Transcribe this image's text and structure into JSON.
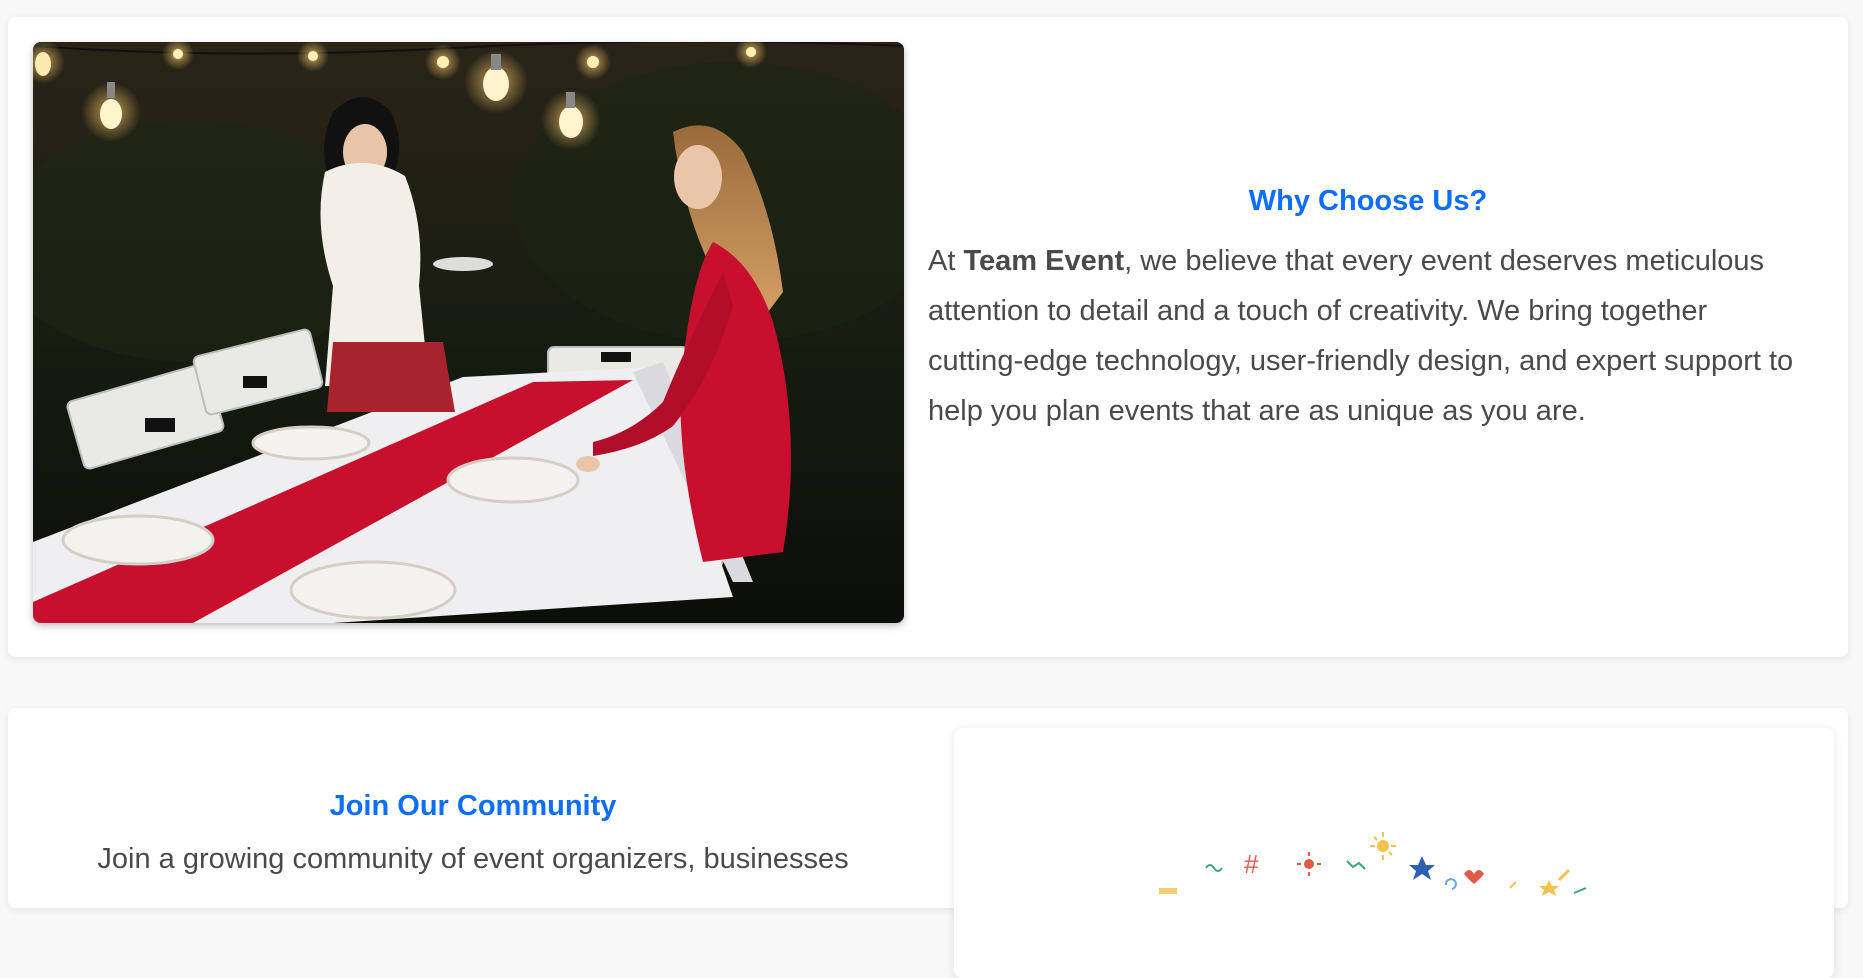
{
  "why_section": {
    "title": "Why Choose Us?",
    "para_prefix": "At ",
    "brand": "Team Event",
    "para_rest": ", we believe that every event deserves meticulous attention to detail and a touch of creativity. We bring together cutting-edge technology, user-friendly design, and expert support to help you plan events that are as unique as you are.",
    "image_alt": "Two women setting a table with a red runner under string lights"
  },
  "join_section": {
    "title": "Join Our Community",
    "para": "Join a growing community of event organizers, businesses"
  },
  "colors": {
    "accent": "#0d6efd",
    "text": "#4a4a4a",
    "background": "#f8f8f8",
    "card": "#ffffff"
  }
}
